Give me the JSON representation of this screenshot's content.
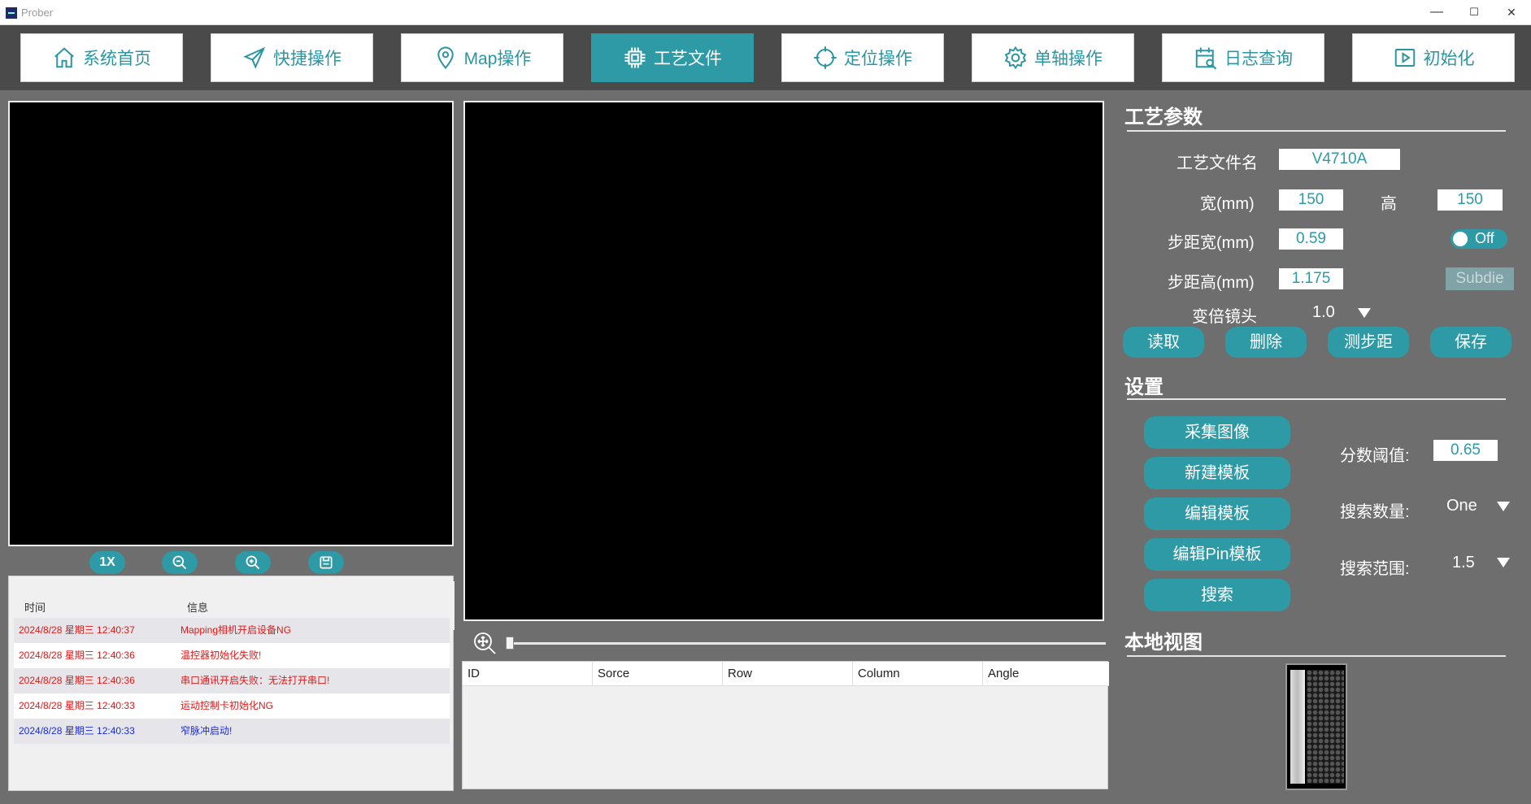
{
  "window": {
    "title": "Prober",
    "minimize": "—",
    "maximize": "☐",
    "close": "✕"
  },
  "nav": {
    "home": "系统首页",
    "quick": "快捷操作",
    "map": "Map操作",
    "recipe": "工艺文件",
    "locate": "定位操作",
    "axis": "单轴操作",
    "log": "日志查询",
    "init": "初始化"
  },
  "zoom": {
    "level": "1X"
  },
  "log": {
    "col_time": "时间",
    "col_info": "信息",
    "rows": [
      {
        "time": "2024/8/28 星期三 12:40:37",
        "msg": "Mapping相机开启设备NG",
        "color": "#e01818"
      },
      {
        "time": "2024/8/28 星期三 12:40:36",
        "msg": "温控器初始化失败!",
        "color": "#e01818"
      },
      {
        "time": "2024/8/28 星期三 12:40:36",
        "msg": "串口通讯开启失败：无法打开串口!",
        "color": "#e01818"
      },
      {
        "time": "2024/8/28 星期三 12:40:33",
        "msg": "运动控制卡初始化NG",
        "color": "#e01818"
      },
      {
        "time": "2024/8/28 星期三 12:40:33",
        "msg": "窄脉冲启动!",
        "color": "#1a2ae0"
      }
    ]
  },
  "results": {
    "columns": [
      "ID",
      "Sorce",
      "Row",
      "Column",
      "Angle"
    ]
  },
  "recipe": {
    "title": "工艺参数",
    "name_label": "工艺文件名",
    "name_value": "V4710A",
    "width_label": "宽(mm)",
    "width_value": "150",
    "height_label": "高",
    "height_value": "150",
    "pitch_w_label": "步距宽(mm)",
    "pitch_w_value": "0.59",
    "toggle_label": "Off",
    "pitch_h_label": "步距高(mm)",
    "pitch_h_value": "1.175",
    "subdie_label": "Subdie",
    "lens_label": "变倍镜头",
    "lens_value": "1.0",
    "btn_read": "读取",
    "btn_delete": "删除",
    "btn_measure": "测步距",
    "btn_save": "保存"
  },
  "settings": {
    "title": "设置",
    "btn_capture": "采集图像",
    "btn_new_template": "新建模板",
    "btn_edit_template": "编辑模板",
    "btn_edit_pin": "编辑Pin模板",
    "btn_search": "搜索",
    "score_label": "分数阈值:",
    "score_value": "0.65",
    "count_label": "搜索数量:",
    "count_value": "One",
    "range_label": "搜索范围:",
    "range_value": "1.5"
  },
  "local_view": {
    "title": "本地视图"
  },
  "colors": {
    "accent": "#2d9aa6",
    "background": "#6e6e6e",
    "toolbar": "#4a4a4a"
  }
}
